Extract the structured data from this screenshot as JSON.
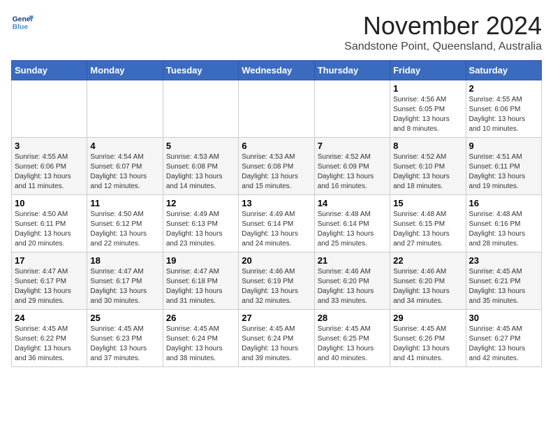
{
  "logo": {
    "line1": "General",
    "line2": "Blue"
  },
  "title": "November 2024",
  "location": "Sandstone Point, Queensland, Australia",
  "weekdays": [
    "Sunday",
    "Monday",
    "Tuesday",
    "Wednesday",
    "Thursday",
    "Friday",
    "Saturday"
  ],
  "weeks": [
    [
      {
        "day": "",
        "info": ""
      },
      {
        "day": "",
        "info": ""
      },
      {
        "day": "",
        "info": ""
      },
      {
        "day": "",
        "info": ""
      },
      {
        "day": "",
        "info": ""
      },
      {
        "day": "1",
        "info": "Sunrise: 4:56 AM\nSunset: 6:05 PM\nDaylight: 13 hours and 8 minutes."
      },
      {
        "day": "2",
        "info": "Sunrise: 4:55 AM\nSunset: 6:06 PM\nDaylight: 13 hours and 10 minutes."
      }
    ],
    [
      {
        "day": "3",
        "info": "Sunrise: 4:55 AM\nSunset: 6:06 PM\nDaylight: 13 hours and 11 minutes."
      },
      {
        "day": "4",
        "info": "Sunrise: 4:54 AM\nSunset: 6:07 PM\nDaylight: 13 hours and 12 minutes."
      },
      {
        "day": "5",
        "info": "Sunrise: 4:53 AM\nSunset: 6:08 PM\nDaylight: 13 hours and 14 minutes."
      },
      {
        "day": "6",
        "info": "Sunrise: 4:53 AM\nSunset: 6:08 PM\nDaylight: 13 hours and 15 minutes."
      },
      {
        "day": "7",
        "info": "Sunrise: 4:52 AM\nSunset: 6:09 PM\nDaylight: 13 hours and 16 minutes."
      },
      {
        "day": "8",
        "info": "Sunrise: 4:52 AM\nSunset: 6:10 PM\nDaylight: 13 hours and 18 minutes."
      },
      {
        "day": "9",
        "info": "Sunrise: 4:51 AM\nSunset: 6:11 PM\nDaylight: 13 hours and 19 minutes."
      }
    ],
    [
      {
        "day": "10",
        "info": "Sunrise: 4:50 AM\nSunset: 6:11 PM\nDaylight: 13 hours and 20 minutes."
      },
      {
        "day": "11",
        "info": "Sunrise: 4:50 AM\nSunset: 6:12 PM\nDaylight: 13 hours and 22 minutes."
      },
      {
        "day": "12",
        "info": "Sunrise: 4:49 AM\nSunset: 6:13 PM\nDaylight: 13 hours and 23 minutes."
      },
      {
        "day": "13",
        "info": "Sunrise: 4:49 AM\nSunset: 6:14 PM\nDaylight: 13 hours and 24 minutes."
      },
      {
        "day": "14",
        "info": "Sunrise: 4:48 AM\nSunset: 6:14 PM\nDaylight: 13 hours and 25 minutes."
      },
      {
        "day": "15",
        "info": "Sunrise: 4:48 AM\nSunset: 6:15 PM\nDaylight: 13 hours and 27 minutes."
      },
      {
        "day": "16",
        "info": "Sunrise: 4:48 AM\nSunset: 6:16 PM\nDaylight: 13 hours and 28 minutes."
      }
    ],
    [
      {
        "day": "17",
        "info": "Sunrise: 4:47 AM\nSunset: 6:17 PM\nDaylight: 13 hours and 29 minutes."
      },
      {
        "day": "18",
        "info": "Sunrise: 4:47 AM\nSunset: 6:17 PM\nDaylight: 13 hours and 30 minutes."
      },
      {
        "day": "19",
        "info": "Sunrise: 4:47 AM\nSunset: 6:18 PM\nDaylight: 13 hours and 31 minutes."
      },
      {
        "day": "20",
        "info": "Sunrise: 4:46 AM\nSunset: 6:19 PM\nDaylight: 13 hours and 32 minutes."
      },
      {
        "day": "21",
        "info": "Sunrise: 4:46 AM\nSunset: 6:20 PM\nDaylight: 13 hours and 33 minutes."
      },
      {
        "day": "22",
        "info": "Sunrise: 4:46 AM\nSunset: 6:20 PM\nDaylight: 13 hours and 34 minutes."
      },
      {
        "day": "23",
        "info": "Sunrise: 4:45 AM\nSunset: 6:21 PM\nDaylight: 13 hours and 35 minutes."
      }
    ],
    [
      {
        "day": "24",
        "info": "Sunrise: 4:45 AM\nSunset: 6:22 PM\nDaylight: 13 hours and 36 minutes."
      },
      {
        "day": "25",
        "info": "Sunrise: 4:45 AM\nSunset: 6:23 PM\nDaylight: 13 hours and 37 minutes."
      },
      {
        "day": "26",
        "info": "Sunrise: 4:45 AM\nSunset: 6:24 PM\nDaylight: 13 hours and 38 minutes."
      },
      {
        "day": "27",
        "info": "Sunrise: 4:45 AM\nSunset: 6:24 PM\nDaylight: 13 hours and 39 minutes."
      },
      {
        "day": "28",
        "info": "Sunrise: 4:45 AM\nSunset: 6:25 PM\nDaylight: 13 hours and 40 minutes."
      },
      {
        "day": "29",
        "info": "Sunrise: 4:45 AM\nSunset: 6:26 PM\nDaylight: 13 hours and 41 minutes."
      },
      {
        "day": "30",
        "info": "Sunrise: 4:45 AM\nSunset: 6:27 PM\nDaylight: 13 hours and 42 minutes."
      }
    ]
  ]
}
